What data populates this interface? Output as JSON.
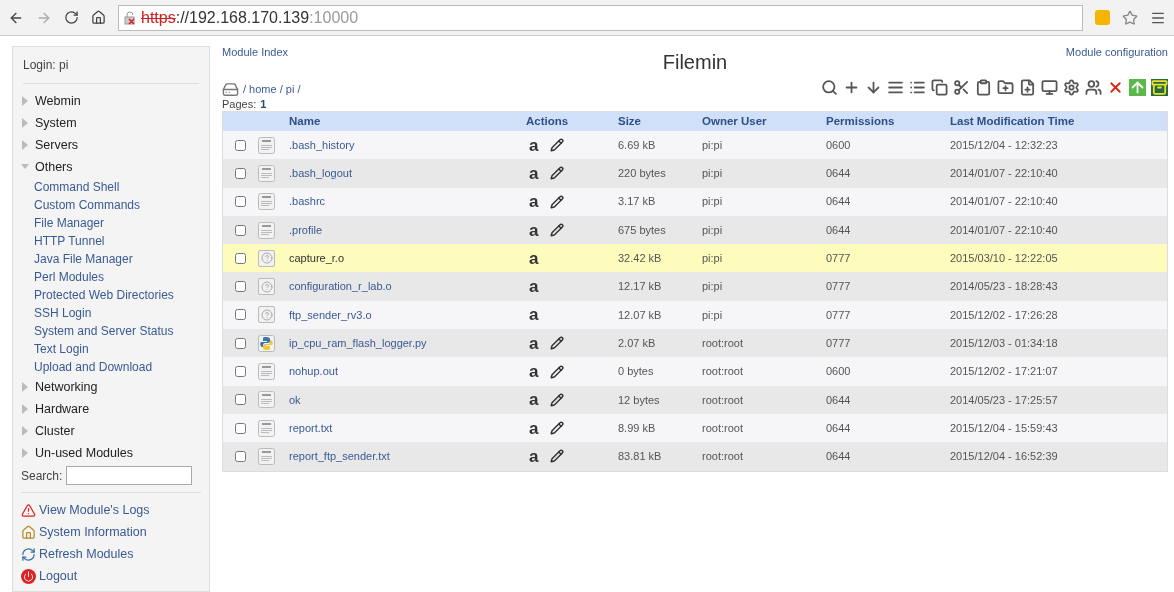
{
  "browser": {
    "url": {
      "scheme": "https",
      "host": "://192.168.170.139",
      "port": ":10000"
    }
  },
  "sidebar": {
    "login": "Login: pi",
    "categories": [
      {
        "label": "Webmin",
        "expanded": false
      },
      {
        "label": "System",
        "expanded": false
      },
      {
        "label": "Servers",
        "expanded": false
      },
      {
        "label": "Others",
        "expanded": true,
        "children": [
          "Command Shell",
          "Custom Commands",
          "File Manager",
          "HTTP Tunnel",
          "Java File Manager",
          "Perl Modules",
          "Protected Web Directories",
          "SSH Login",
          "System and Server Status",
          "Text Login",
          "Upload and Download"
        ]
      },
      {
        "label": "Networking",
        "expanded": false
      },
      {
        "label": "Hardware",
        "expanded": false
      },
      {
        "label": "Cluster",
        "expanded": false
      },
      {
        "label": "Un-used Modules",
        "expanded": false
      }
    ],
    "search_label": "Search:",
    "links": [
      {
        "kind": "logs",
        "label": "View Module's Logs"
      },
      {
        "kind": "sysinfo",
        "label": "System Information"
      },
      {
        "kind": "refresh",
        "label": "Refresh Modules"
      },
      {
        "kind": "logout",
        "label": "Logout"
      }
    ]
  },
  "header": {
    "left_link": "Module Index",
    "title": "Filemin",
    "right_link": "Module configuration"
  },
  "path": "/ home / pi /",
  "pages_label": "Pages:",
  "pages": [
    {
      "label": "1",
      "selected": true
    }
  ],
  "table": {
    "columns": [
      "Name",
      "Actions",
      "Size",
      "Owner User",
      "Permissions",
      "Last Modification Time"
    ],
    "rows": [
      {
        "kind": "text",
        "name": ".bash_history",
        "actions": "a",
        "editable": true,
        "size": "6.69 kB",
        "owner": "pi:pi",
        "perms": "0600",
        "time": "2015/12/04 - 12:32:23",
        "highlighted": false,
        "checked": false
      },
      {
        "kind": "text",
        "name": ".bash_logout",
        "actions": "a",
        "editable": true,
        "size": "220 bytes",
        "owner": "pi:pi",
        "perms": "0644",
        "time": "2014/01/07 - 22:10:40",
        "highlighted": false,
        "checked": false
      },
      {
        "kind": "text",
        "name": ".bashrc",
        "actions": "a",
        "editable": true,
        "size": "3.17 kB",
        "owner": "pi:pi",
        "perms": "0644",
        "time": "2014/01/07 - 22:10:40",
        "highlighted": false,
        "checked": false
      },
      {
        "kind": "text",
        "name": ".profile",
        "actions": "a",
        "editable": true,
        "size": "675 bytes",
        "owner": "pi:pi",
        "perms": "0644",
        "time": "2014/01/07 - 22:10:40",
        "highlighted": false,
        "checked": false
      },
      {
        "kind": "unknown",
        "name": "capture_r.o",
        "actions": "a",
        "editable": false,
        "size": "32.42 kB",
        "owner": "pi:pi",
        "perms": "0777",
        "time": "2015/03/10 - 12:22:05",
        "highlighted": true,
        "checked": false
      },
      {
        "kind": "unknown",
        "name": "configuration_r_lab.o",
        "actions": "a",
        "editable": false,
        "size": "12.17 kB",
        "owner": "pi:pi",
        "perms": "0777",
        "time": "2014/05/23 - 18:28:43",
        "highlighted": false,
        "checked": false
      },
      {
        "kind": "unknown",
        "name": "ftp_sender_rv3.o",
        "actions": "a",
        "editable": false,
        "size": "12.07 kB",
        "owner": "pi:pi",
        "perms": "0777",
        "time": "2015/12/02 - 17:26:28",
        "highlighted": false,
        "checked": false
      },
      {
        "kind": "python",
        "name": "ip_cpu_ram_flash_logger.py",
        "actions": "a",
        "editable": true,
        "size": "2.07 kB",
        "owner": "root:root",
        "perms": "0777",
        "time": "2015/12/03 - 01:34:18",
        "highlighted": false,
        "checked": false
      },
      {
        "kind": "text",
        "name": "nohup.out",
        "actions": "a",
        "editable": true,
        "size": "0 bytes",
        "owner": "root:root",
        "perms": "0600",
        "time": "2015/12/02 - 17:21:07",
        "highlighted": false,
        "checked": false
      },
      {
        "kind": "text",
        "name": "ok",
        "actions": "a",
        "editable": true,
        "size": "12 bytes",
        "owner": "root:root",
        "perms": "0644",
        "time": "2014/05/23 - 17:25:57",
        "highlighted": false,
        "checked": false
      },
      {
        "kind": "text",
        "name": "report.txt",
        "actions": "a",
        "editable": true,
        "size": "8.99 kB",
        "owner": "root:root",
        "perms": "0644",
        "time": "2015/12/04 - 15:59:43",
        "highlighted": false,
        "checked": false
      },
      {
        "kind": "text",
        "name": "report_ftp_sender.txt",
        "actions": "a",
        "editable": true,
        "size": "83.81 kB",
        "owner": "root:root",
        "perms": "0644",
        "time": "2015/12/04 - 16:52:39",
        "highlighted": false,
        "checked": false
      }
    ]
  }
}
